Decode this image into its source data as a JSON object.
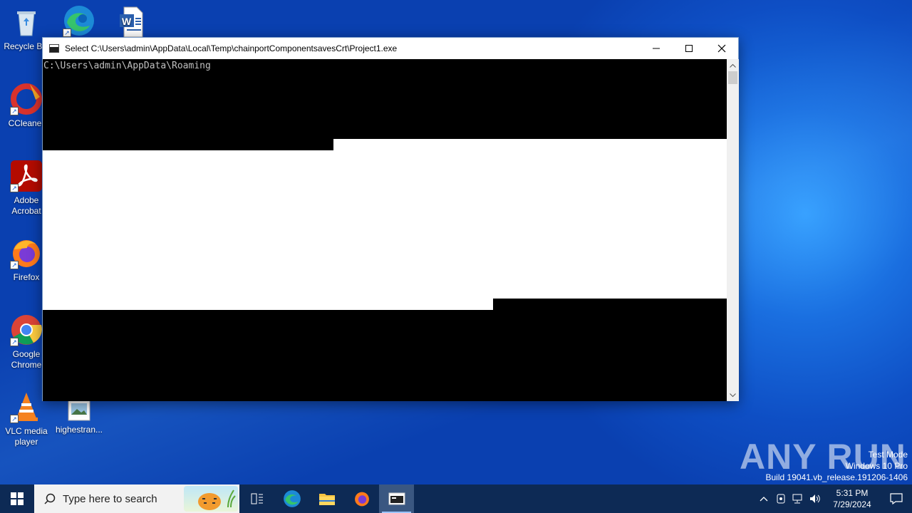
{
  "desktop": {
    "icons": [
      {
        "label": "Recycle Bin",
        "icon": "recycle-bin-icon"
      },
      {
        "label": "",
        "icon": "edge-icon"
      },
      {
        "label": "",
        "icon": "word-document-icon"
      },
      {
        "label": "CCleaner",
        "icon": "ccleaner-icon"
      },
      {
        "label": "Adobe Acrobat",
        "icon": "acrobat-icon"
      },
      {
        "label": "Firefox",
        "icon": "firefox-icon"
      },
      {
        "label": "Google Chrome",
        "icon": "chrome-icon"
      },
      {
        "label": "VLC media player",
        "icon": "vlc-icon"
      },
      {
        "label": "highestran...",
        "icon": "image-file-icon"
      }
    ]
  },
  "window": {
    "title": "Select C:\\Users\\admin\\AppData\\Local\\Temp\\chainportComponentsavesCrt\\Project1.exe",
    "console_text": "C:\\Users\\admin\\AppData\\Roaming",
    "controls": {
      "minimize": "minimize",
      "maximize": "maximize",
      "close": "close"
    }
  },
  "watermark": {
    "brand": "ANY RUN",
    "line1": "Test Mode",
    "line2": "Windows 10 Pro",
    "line3": "Build 19041.vb_release.191206-1406"
  },
  "taskbar": {
    "search_placeholder": "Type here to search",
    "apps": [
      "task-view",
      "edge",
      "file-explorer",
      "firefox",
      "console"
    ],
    "clock_time": "5:31 PM",
    "clock_date": "7/29/2024"
  },
  "colors": {
    "accent": "#0a47bb",
    "taskbar": "#0d2a55",
    "console_bg": "#000000",
    "console_fg": "#c0c0c0"
  }
}
